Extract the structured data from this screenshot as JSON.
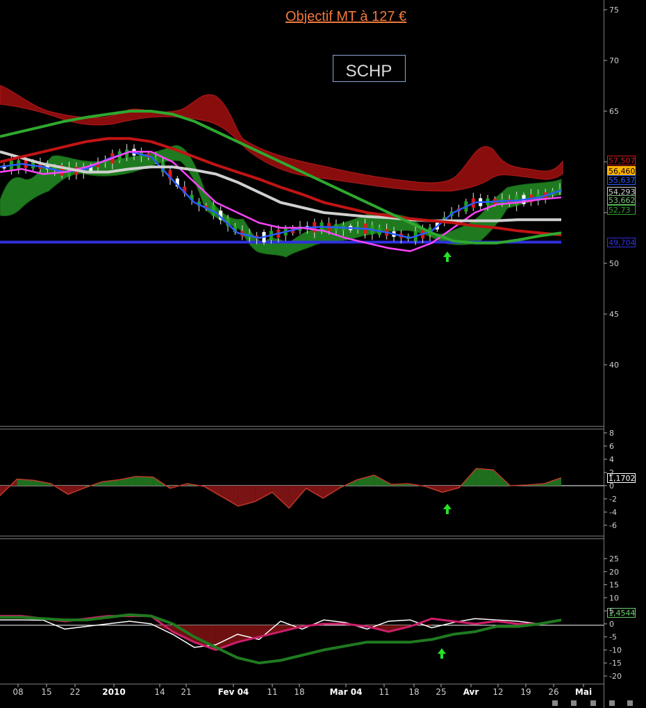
{
  "title": "Objectif MT à 127 €",
  "chart_data": [
    {
      "type": "line",
      "panel": "price",
      "symbol": "SCHP",
      "ylim": [
        35,
        76
      ],
      "y_ticks": [
        "75",
        "70",
        "65",
        "60",
        "",
        "50",
        "45",
        "40"
      ],
      "x_labels": [
        "08",
        "15",
        "22",
        "2010",
        "14",
        "21",
        "Fev 04",
        "11",
        "18",
        "Mar 04",
        "11",
        "18",
        "25",
        "Avr",
        "12",
        "19",
        "26",
        "Mai"
      ],
      "price_tags": [
        {
          "label": "57,507",
          "value": 57.5,
          "color": "#d41c1c"
        },
        {
          "label": "56,460",
          "value": 56.46,
          "color": "#ffb100"
        },
        {
          "label": "55,637",
          "value": 55.6,
          "color": "#2a5cff"
        },
        {
          "label": "54,293",
          "value": 54.3,
          "color": "#cfcfcf"
        },
        {
          "label": "53,662",
          "value": 53.66,
          "color": "#7ec27e"
        },
        {
          "label": "52,73",
          "value": 52.73,
          "color": "#2fa82f"
        },
        {
          "label": "49,704",
          "value": 49.7,
          "color": "#3030e0"
        }
      ],
      "support_line": 49.7,
      "series": [
        {
          "color": "#2a5cff",
          "values": [
            59.5,
            59.8,
            59.5,
            59.0,
            59.3,
            60.3,
            61.0,
            60.5,
            58.2,
            56.0,
            55.0,
            53.0,
            52.5,
            53.0,
            53.5,
            53.6,
            53.5,
            53.4,
            53.0,
            52.5,
            53.2,
            55.0,
            56.0,
            56.1,
            56.2,
            56.5,
            57.2
          ]
        },
        {
          "color": "#ff44ff",
          "values": [
            59.0,
            59.3,
            58.8,
            59.0,
            59.5,
            60.2,
            61.0,
            61.0,
            60.0,
            58.0,
            56.0,
            55.0,
            54.0,
            53.5,
            53.5,
            53.2,
            52.5,
            52.0,
            51.5,
            51.2,
            52.0,
            53.5,
            55.0,
            55.8,
            56.0,
            56.3,
            56.5
          ]
        },
        {
          "color": "#d0d0d0",
          "values": [
            61.0,
            60.4,
            59.8,
            59.4,
            59.0,
            59.0,
            59.3,
            59.5,
            59.5,
            59.2,
            58.8,
            58.0,
            57.0,
            56.0,
            55.5,
            55.0,
            54.8,
            54.6,
            54.5,
            54.3,
            54.2,
            54.2,
            54.2,
            54.2,
            54.3,
            54.3,
            54.3
          ]
        },
        {
          "color": "#c21414",
          "values": [
            60.0,
            60.5,
            61.0,
            61.5,
            62.0,
            62.3,
            62.3,
            62.0,
            61.3,
            60.5,
            59.7,
            59.0,
            58.3,
            57.5,
            56.8,
            56.0,
            55.5,
            55.0,
            54.7,
            54.4,
            54.2,
            54.0,
            53.7,
            53.5,
            53.2,
            53.0,
            52.8
          ]
        },
        {
          "color": "#2fa82f",
          "values": [
            62.5,
            63.0,
            63.5,
            64.0,
            64.4,
            64.7,
            65.0,
            65.0,
            64.7,
            64.0,
            63.0,
            62.0,
            61.0,
            60.0,
            59.0,
            58.0,
            57.0,
            56.0,
            55.0,
            54.0,
            53.0,
            52.2,
            52.0,
            52.0,
            52.3,
            52.7,
            53.0
          ]
        }
      ]
    },
    {
      "type": "area",
      "panel": "oscillator",
      "ylim": [
        -7,
        9
      ],
      "y_ticks": [
        "8",
        "6",
        "4",
        "2",
        "0",
        "-2",
        "-4",
        "-6"
      ],
      "last_value": "1,1702",
      "values": [
        -1.5,
        1.0,
        0.8,
        0.3,
        -1.3,
        -0.3,
        0.6,
        0.9,
        1.4,
        1.3,
        -0.4,
        0.3,
        -0.1,
        -1.6,
        -3.1,
        -2.4,
        -1.0,
        -3.4,
        -0.4,
        -1.9,
        -0.3,
        0.9,
        1.6,
        0.2,
        0.3,
        -0.1,
        -1.0,
        -0.3,
        2.6,
        2.4,
        0.0,
        0.1,
        0.3,
        1.2
      ]
    },
    {
      "type": "line",
      "panel": "momentum",
      "ylim": [
        -21,
        27
      ],
      "y_ticks": [
        "25",
        "20",
        "15",
        "10",
        "5",
        "0",
        "-5",
        "-10",
        "-15",
        "-20"
      ],
      "last_value": "1,4544",
      "series": [
        {
          "color": "#ffffff",
          "values": [
            1.5,
            1.5,
            1.4,
            -2.0,
            -1.0,
            0.0,
            1.0,
            0.0,
            -4.0,
            -9.0,
            -8.0,
            -4.0,
            -6.0,
            1.0,
            -2.0,
            1.5,
            0.5,
            -2.0,
            1.0,
            1.5,
            -1.5,
            0.5,
            2.0,
            1.5,
            1.0,
            0.0,
            1.5
          ]
        },
        {
          "color": "#cc1f6a",
          "values": [
            3.0,
            3.0,
            2.0,
            1.0,
            2.0,
            3.0,
            3.0,
            3.0,
            -3.0,
            -7.0,
            -10.0,
            -7.0,
            -5.0,
            -3.0,
            -1.0,
            0.0,
            0.0,
            -1.0,
            -3.0,
            -1.0,
            2.0,
            1.0,
            0.0,
            1.0,
            0.0,
            0.0,
            1.5
          ]
        },
        {
          "color": "#1f7a1f",
          "values": [
            2.5,
            2.5,
            2.0,
            1.5,
            1.5,
            2.5,
            3.5,
            3.0,
            0.0,
            -5.0,
            -9.0,
            -13.0,
            -15.0,
            -14.0,
            -12.0,
            -10.0,
            -8.5,
            -7.0,
            -7.0,
            -7.0,
            -6.0,
            -4.0,
            -3.0,
            -1.0,
            -1.0,
            0.0,
            1.5
          ]
        }
      ]
    }
  ]
}
